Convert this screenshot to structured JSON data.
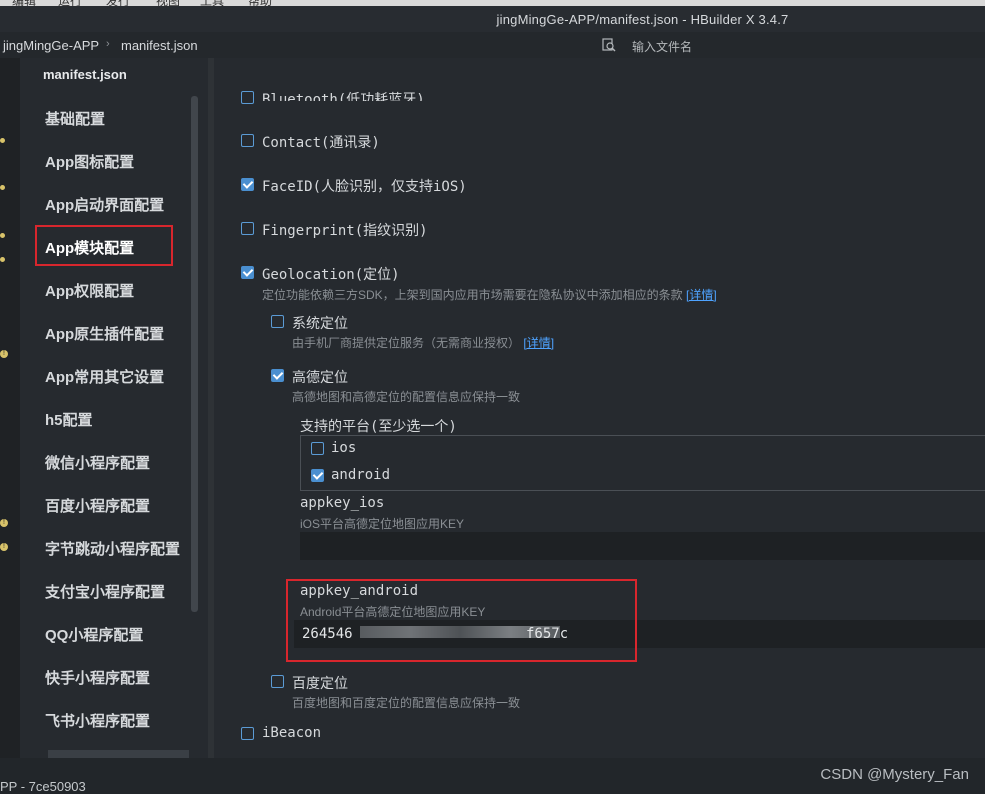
{
  "menubar": {
    "items": [
      "编辑",
      "运行",
      "发行",
      "视图",
      "工具",
      "帮助"
    ]
  },
  "window": {
    "title": "jingMingGe-APP/manifest.json - HBuilder X 3.4.7"
  },
  "breadcrumb": {
    "project": "jingMingGe-APP",
    "file": "manifest.json"
  },
  "file_search": {
    "placeholder": "输入文件名"
  },
  "editor_tab": {
    "label": "manifest.json"
  },
  "sidebar": {
    "items": [
      {
        "label": "基础配置"
      },
      {
        "label": "App图标配置"
      },
      {
        "label": "App启动界面配置"
      },
      {
        "label": "App模块配置",
        "active": true
      },
      {
        "label": "App权限配置"
      },
      {
        "label": "App原生插件配置"
      },
      {
        "label": "App常用其它设置"
      },
      {
        "label": "h5配置"
      },
      {
        "label": "微信小程序配置"
      },
      {
        "label": "百度小程序配置"
      },
      {
        "label": "字节跳动小程序配置"
      },
      {
        "label": "支付宝小程序配置"
      },
      {
        "label": "QQ小程序配置"
      },
      {
        "label": "快手小程序配置"
      },
      {
        "label": "飞书小程序配置"
      }
    ]
  },
  "modules": {
    "bluetooth": {
      "label": "Bluetooth(低功耗蓝牙)",
      "checked": false
    },
    "contact": {
      "label": "Contact(通讯录)",
      "checked": false
    },
    "faceid": {
      "label": "FaceID(人脸识别，仅支持iOS)",
      "checked": true
    },
    "fingerprint": {
      "label": "Fingerprint(指纹识别)",
      "checked": false
    },
    "geolocation": {
      "label": "Geolocation(定位)",
      "checked": true,
      "desc": "定位功能依赖三方SDK，上架到国内应用市场需要在隐私协议中添加相应的条款",
      "detail_link": "[详情]"
    },
    "system_location": {
      "label": "系统定位",
      "checked": false,
      "desc": "由手机厂商提供定位服务（无需商业授权）",
      "detail_link": "[详情]"
    },
    "amap": {
      "label": "高德定位",
      "checked": true,
      "desc": "高德地图和高德定位的配置信息应保持一致",
      "platforms_label": "支持的平台(至少选一个)",
      "platforms": [
        {
          "label": "ios",
          "checked": false
        },
        {
          "label": "android",
          "checked": true
        }
      ],
      "appkey_ios": {
        "label": "appkey_ios",
        "desc": "iOS平台高德定位地图应用KEY",
        "value": ""
      },
      "appkey_android": {
        "label": "appkey_android",
        "desc": "Android平台高德定位地图应用KEY",
        "value_prefix": "264546",
        "value_suffix": "f657c"
      }
    },
    "baidu_location": {
      "label": "百度定位",
      "checked": false,
      "desc": "百度地图和百度定位的配置信息应保持一致"
    },
    "ibeacon": {
      "label": "iBeacon",
      "checked": false
    }
  },
  "statusbar": {
    "text": "PP - 7ce50903"
  },
  "watermark": {
    "text": "CSDN @Mystery_Fan"
  },
  "colors": {
    "highlight_border": "#d8262d",
    "link": "#4ea3ff",
    "checkbox": "#4a8fd0"
  }
}
